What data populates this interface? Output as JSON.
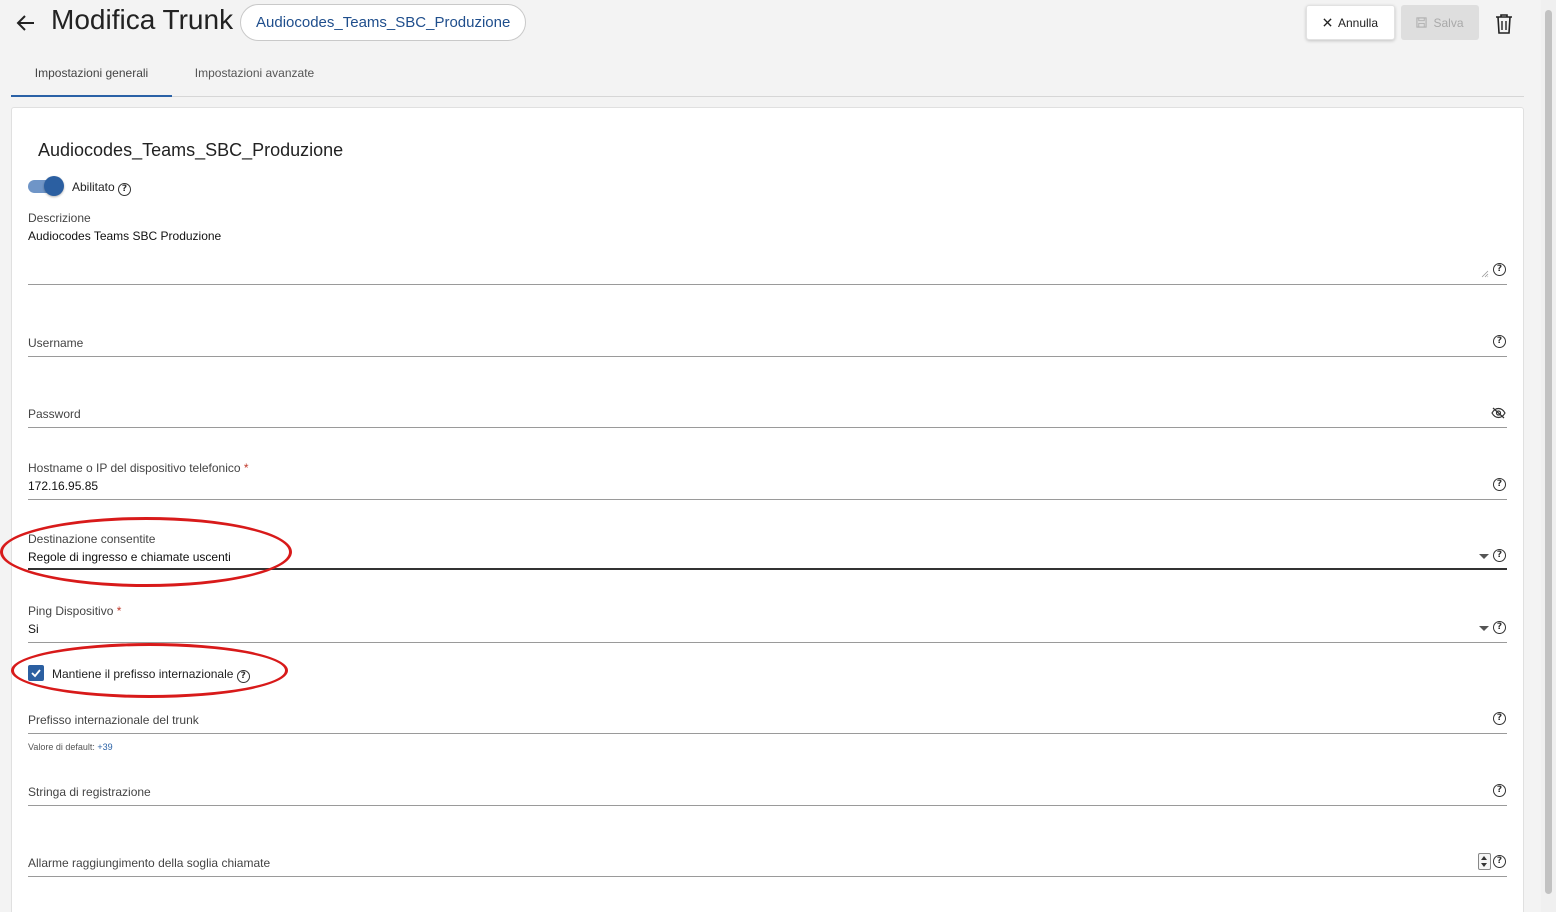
{
  "header": {
    "title": "Modifica Trunk",
    "trunk_pill": "Audiocodes_Teams_SBC_Produzione",
    "cancel_label": "Annulla",
    "save_label": "Salva"
  },
  "tabs": [
    {
      "label": "Impostazioni generali",
      "active": true
    },
    {
      "label": "Impostazioni avanzate",
      "active": false
    }
  ],
  "form": {
    "section_title": "Audiocodes_Teams_SBC_Produzione",
    "enabled": {
      "label": "Abilitato",
      "on": true
    },
    "description": {
      "label": "Descrizione",
      "value": "Audiocodes Teams SBC Produzione"
    },
    "username": {
      "label": "Username",
      "value": ""
    },
    "password": {
      "label": "Password",
      "value": ""
    },
    "hostname": {
      "label": "Hostname o IP del dispositivo telefonico",
      "required_mark": "*",
      "value": "172.16.95.85"
    },
    "destination": {
      "label": "Destinazione consentite",
      "value": "Regole di ingresso e chiamate uscenti"
    },
    "ping": {
      "label": "Ping Dispositivo",
      "required_mark": "*",
      "value": "Si"
    },
    "keep_prefix": {
      "label": "Mantiene il prefisso internazionale",
      "checked": true
    },
    "trunk_prefix": {
      "label": "Prefisso internazionale del trunk",
      "value": "",
      "hint_label": "Valore di default:",
      "hint_value": "+39"
    },
    "registration": {
      "label": "Stringa di registrazione",
      "value": ""
    },
    "call_alarm": {
      "label": "Allarme raggiungimento della soglia chiamate",
      "value": ""
    }
  },
  "colors": {
    "accent": "#2b5fa1",
    "annotation": "#d81a1a",
    "required": "#c0392b"
  }
}
